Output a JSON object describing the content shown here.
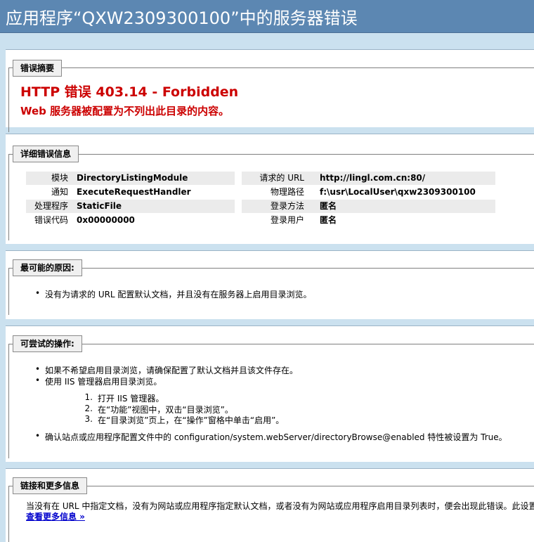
{
  "header": {
    "title": "应用程序“QXW2309300100”中的服务器错误"
  },
  "summary": {
    "legend": "错误摘要",
    "title": "HTTP 错误 403.14 - Forbidden",
    "subtitle": "Web 服务器被配置为不列出此目录的内容。"
  },
  "details": {
    "legend": "详细错误信息",
    "left": [
      {
        "key": "模块",
        "value": "DirectoryListingModule"
      },
      {
        "key": "通知",
        "value": "ExecuteRequestHandler"
      },
      {
        "key": "处理程序",
        "value": "StaticFile"
      },
      {
        "key": "错误代码",
        "value": "0x00000000"
      }
    ],
    "right": [
      {
        "key": "请求的 URL",
        "value": "http://lingl.com.cn:80/"
      },
      {
        "key": "物理路径",
        "value": "f:\\usr\\LocalUser\\qxw2309300100"
      },
      {
        "key": "登录方法",
        "value": "匿名"
      },
      {
        "key": "登录用户",
        "value": "匿名"
      }
    ]
  },
  "causes": {
    "legend": "最可能的原因:",
    "items": [
      "没有为请求的 URL 配置默认文档，并且没有在服务器上启用目录浏览。"
    ]
  },
  "actions": {
    "legend": "可尝试的操作:",
    "items": [
      "如果不希望启用目录浏览，请确保配置了默认文档并且该文件存在。",
      "使用 IIS 管理器启用目录浏览。"
    ],
    "steps": [
      "打开 IIS 管理器。",
      "在“功能”视图中，双击“目录浏览”。",
      "在“目录浏览”页上，在“操作”窗格中单击“启用”。"
    ],
    "last": "确认站点或应用程序配置文件中的 configuration/system.webServer/directoryBrowse@enabled 特性被设置为 True。"
  },
  "links": {
    "legend": "链接和更多信息",
    "text": "当没有在 URL 中指定文档，没有为网站或应用程序指定默认文档，或者没有为网站或应用程序启用目录列表时，便会出现此错误。此设置",
    "more": "查看更多信息 »"
  }
}
